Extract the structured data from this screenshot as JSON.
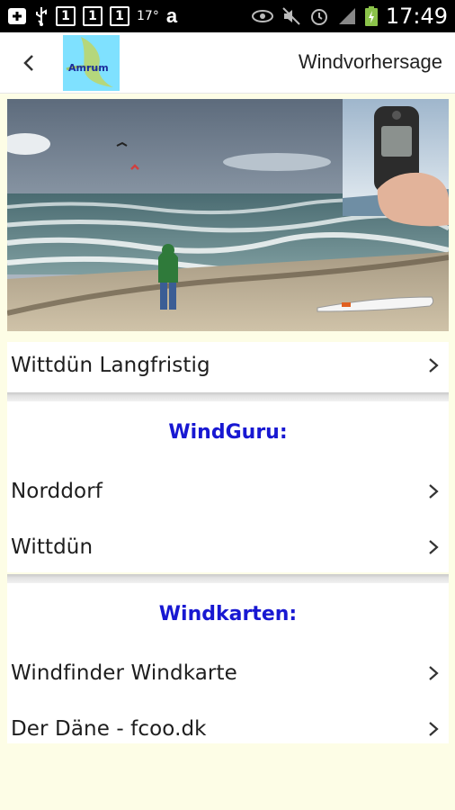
{
  "status_bar": {
    "left_icons": [
      "add-box-icon",
      "usb-icon",
      "sim1-icon",
      "sim2-icon",
      "sim3-icon"
    ],
    "box_digits": [
      "1",
      "1",
      "1"
    ],
    "temperature": "17°",
    "right_icons": [
      "eye-icon",
      "mute-icon",
      "alarm-icon",
      "signal-icon",
      "battery-icon"
    ],
    "time": "17:49"
  },
  "action_bar": {
    "logo_text": "Amrum",
    "title": "Windvorhersage"
  },
  "rows": {
    "long_term": "Wittdün Langfristig"
  },
  "windguru": {
    "heading": "WindGuru:",
    "items": [
      "Norddorf",
      "Wittdün"
    ]
  },
  "windkarten": {
    "heading": "Windkarten:",
    "items": [
      "Windfinder Windkarte",
      "Der Däne - fcoo.dk"
    ]
  },
  "colors": {
    "background": "#fdfde6",
    "heading_blue": "#1818d2",
    "logo_cyan": "#7fe1ff"
  }
}
